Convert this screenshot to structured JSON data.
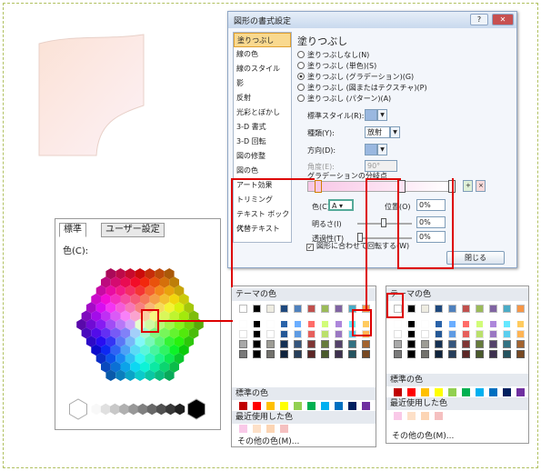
{
  "dialog": {
    "title": "図形の書式設定",
    "help": "?",
    "close": "✕",
    "nav": [
      "塗りつぶし",
      "線の色",
      "線のスタイル",
      "影",
      "反射",
      "光彩とぼかし",
      "3-D 書式",
      "3-D 回転",
      "図の修整",
      "図の色",
      "アート効果",
      "トリミング",
      "テキスト ボックス",
      "代替テキスト"
    ],
    "panel_title": "塗りつぶし",
    "options": [
      "塗りつぶしなし(N)",
      "塗りつぶし (単色)(S)",
      "塗りつぶし (グラデーション)(G)",
      "塗りつぶし (図またはテクスチャ)(P)",
      "塗りつぶし (パターン)(A)"
    ],
    "preset_label": "標準スタイル(R):",
    "type_label": "種類(Y):",
    "type_value": "放射",
    "direction_label": "方向(D):",
    "angle_label": "角度(E):",
    "angle_value": "90°",
    "stops_label": "グラデーションの分岐点",
    "color_label": "色(C)",
    "position_label": "位置(O)",
    "position_value": "0%",
    "brightness_label": "明るさ(I)",
    "brightness_value": "0%",
    "transparency_label": "透過性(T)",
    "transparency_value": "0%",
    "rotate_label": "図形に合わせて回転する(W)",
    "close_button": "閉じる"
  },
  "std_colors": {
    "tab1": "標準",
    "tab2": "ユーザー設定",
    "color_label": "色(C):"
  },
  "palette_left": {
    "theme": "テーマの色",
    "standard": "標準の色",
    "recent": "最近使用した色",
    "more": "その他の色(M)..."
  },
  "palette_right": {
    "theme": "テーマの色",
    "standard": "標準の色",
    "recent": "最近使用した色",
    "more": "その他の色(M)..."
  },
  "theme_top": [
    "#ffffff",
    "#000000",
    "#eeece1",
    "#1f497d",
    "#4f81bd",
    "#c0504d",
    "#9bbb59",
    "#8064a2",
    "#4bacc6",
    "#f79646"
  ],
  "standard_colors": [
    "#c00000",
    "#ff0000",
    "#ffc000",
    "#ffff00",
    "#92d050",
    "#00b050",
    "#00b0f0",
    "#0070c0",
    "#002060",
    "#7030a0"
  ],
  "recent_colors": [
    "#f9c9e8",
    "#fde0c8",
    "#fcd5b4",
    "#f5c0c0"
  ]
}
